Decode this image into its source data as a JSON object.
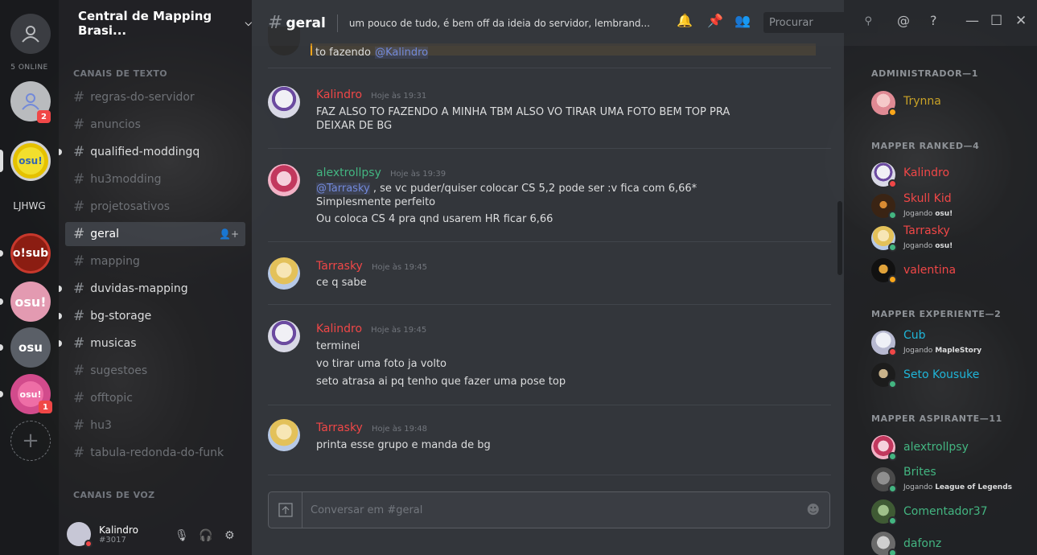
{
  "rail": {
    "online": "5 ONLINE",
    "label": "LJHWG",
    "badge_friends": "2",
    "badge_osu4": "1",
    "servers": {
      "osub": "o!sub",
      "osu": "osu!",
      "osu2": "osu!",
      "osu3": "osu",
      "osu4": "osu!",
      "add": "+"
    }
  },
  "server": {
    "name": "Central de Mapping Brasi...",
    "text_category": "CANAIS DE TEXTO",
    "voice_category": "CANAIS DE VOZ",
    "channels": [
      {
        "name": "regras-do-servidor"
      },
      {
        "name": "anuncios"
      },
      {
        "name": "qualified-moddingq"
      },
      {
        "name": "hu3modding"
      },
      {
        "name": "projetosativos"
      },
      {
        "name": "geral"
      },
      {
        "name": "mapping"
      },
      {
        "name": "duvidas-mapping"
      },
      {
        "name": "bg-storage"
      },
      {
        "name": "musicas"
      },
      {
        "name": "sugestoes"
      },
      {
        "name": "offtopic"
      },
      {
        "name": "hu3"
      },
      {
        "name": "tabula-redonda-do-funk"
      }
    ]
  },
  "user": {
    "name": "Kalindro",
    "tag": "#3017"
  },
  "topbar": {
    "channel": "geral",
    "topic": "um pouco de tudo, é bem off da ideia do servidor, lembrand...",
    "search_placeholder": "Procurar"
  },
  "chat": {
    "partial_line": "to fazendo",
    "partial_mention": "@Kalindro",
    "messages": [
      {
        "author": "Kalindro",
        "color": "#f04747",
        "time": "Hoje às 19:31",
        "lines": [
          "FAZ ALSO TO FAZENDO A MINHA TBM ALSO VO TIRAR UMA FOTO BEM TOP PRA",
          "DEIXAR DE BG"
        ]
      },
      {
        "author": "alextrollpsy",
        "color": "#43b581",
        "time": "Hoje às 19:39",
        "mention": "@Tarrasky",
        "lines": [
          " , se vc puder/quiser colocar CS 5,2 pode ser  :v fica com 6,66*",
          "Simplesmente perfeito",
          "Ou coloca CS 4 pra qnd usarem HR ficar 6,66"
        ]
      },
      {
        "author": "Tarrasky",
        "color": "#f04747",
        "time": "Hoje às 19:45",
        "lines": [
          "ce q sabe"
        ]
      },
      {
        "author": "Kalindro",
        "color": "#f04747",
        "time": "Hoje às 19:45",
        "lines": [
          "terminei",
          "vo tirar uma foto ja volto",
          "seto atrasa ai pq tenho que fazer uma pose top"
        ]
      },
      {
        "author": "Tarrasky",
        "color": "#f04747",
        "time": "Hoje às 19:48",
        "lines": [
          "printa esse grupo e manda de bg"
        ]
      }
    ],
    "composer_placeholder": "Conversar em #geral"
  },
  "members": {
    "groups": [
      {
        "title": "ADMINISTRADOR—1"
      },
      {
        "title": "MAPPER RANKED—4"
      },
      {
        "title": "MAPPER EXPERIENTE—2"
      },
      {
        "title": "MAPPER ASPIRANTE—11"
      }
    ],
    "list": [
      {
        "name": "Trynna",
        "color": "#c9a227",
        "status": "#faa61a"
      },
      {
        "name": "Kalindro",
        "color": "#f04747",
        "status": "#f04747"
      },
      {
        "name": "Skull Kid",
        "color": "#f04747",
        "status": "#43b581",
        "activity_prefix": "Jogando ",
        "activity": "osu!"
      },
      {
        "name": "Tarrasky",
        "color": "#f04747",
        "status": "#43b581",
        "activity_prefix": "Jogando ",
        "activity": "osu!"
      },
      {
        "name": "valentina",
        "color": "#f04747",
        "status": "#faa61a"
      },
      {
        "name": "Cub",
        "color": "#1fb5d8",
        "status": "#f04747",
        "activity_prefix": "Jogando ",
        "activity": "MapleStory"
      },
      {
        "name": "Seto Kousuke",
        "color": "#1fb5d8",
        "status": "#43b581"
      },
      {
        "name": "alextrollpsy",
        "color": "#43b581",
        "status": "#43b581"
      },
      {
        "name": "Brites",
        "color": "#43b581",
        "status": "#43b581",
        "activity_prefix": "Jogando ",
        "activity": "League of Legends"
      },
      {
        "name": "Comentador37",
        "color": "#43b581",
        "status": "#43b581"
      },
      {
        "name": "dafonz",
        "color": "#43b581",
        "status": "#43b581"
      }
    ]
  },
  "icons": {
    "bell": "bell-icon",
    "pin": "pin-icon",
    "members": "members-icon",
    "at": "at-icon",
    "help": "help-icon",
    "search": "search-icon"
  }
}
